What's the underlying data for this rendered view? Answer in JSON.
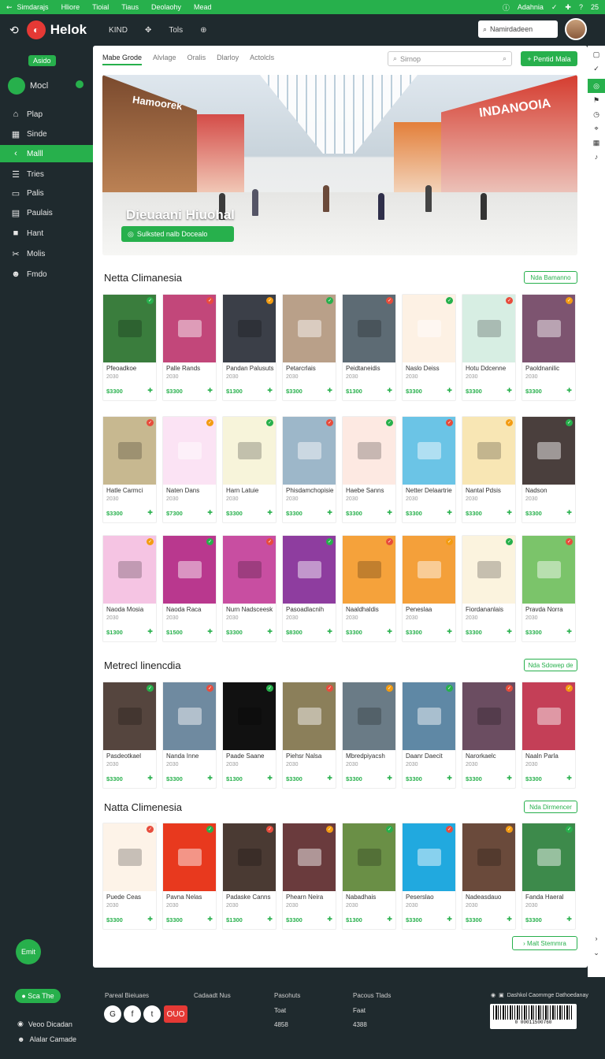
{
  "topbar": {
    "left": "Simdarajs",
    "nav": [
      "Hliore",
      "Tioial",
      "Tiaus",
      "Deolaohy",
      "Mead"
    ],
    "right": "Adahnia",
    "count": "25"
  },
  "header": {
    "logo": "Helok",
    "nav": [
      "KIND",
      "Tols"
    ],
    "search": "Namirdadeen"
  },
  "sidebar": {
    "badge": "Asido",
    "user": "Mocl",
    "items": [
      {
        "label": "Plap",
        "icon": "home-icon"
      },
      {
        "label": "Sinde",
        "icon": "grid-icon"
      },
      {
        "label": "Malll",
        "icon": "cart-icon",
        "active": true
      },
      {
        "label": "Tries",
        "icon": "list-icon"
      },
      {
        "label": "Palis",
        "icon": "card-icon"
      },
      {
        "label": "Paulais",
        "icon": "chart-icon"
      },
      {
        "label": "Hant",
        "icon": "box-icon"
      },
      {
        "label": "Molis",
        "icon": "tools-icon"
      },
      {
        "label": "Fmdo",
        "icon": "people-icon"
      }
    ],
    "fab": "Emit"
  },
  "main": {
    "tabs": [
      "Mabe Grode",
      "Alvlage",
      "Oralis",
      "Dlarloy",
      "Actolcls"
    ],
    "search_placeholder": "Sirnop",
    "primary_button": "Pentid Mala",
    "hero": {
      "title": "Dieuaani Hiuohal",
      "button": "Sulksted nalb Docealo",
      "store_left": "Hamoorek",
      "store_right": "INDANOOIA"
    },
    "sections": [
      {
        "title": "Netta Climanesia",
        "button": "Nda Bamanno",
        "rows": 3
      },
      {
        "title": "Metrecl linencdia",
        "button": "Nda Sdowep de",
        "rows": 1
      },
      {
        "title": "Natta Climenesia",
        "button": "Nda Dirmencer",
        "rows": 1
      }
    ],
    "more_button": "Malt Stemmra"
  },
  "products": [
    [
      {
        "name": "Pfeoadkoe",
        "sub": "2030",
        "price": "$3300",
        "bg": "#3a7d3d"
      },
      {
        "name": "Palle Rands",
        "sub": "2030",
        "price": "$3300",
        "bg": "#c2477a"
      },
      {
        "name": "Pandan Palusuts",
        "sub": "2030",
        "price": "$1300",
        "bg": "#3b3f48"
      },
      {
        "name": "Petarcrlais",
        "sub": "2030",
        "price": "$3300",
        "bg": "#b9a089"
      },
      {
        "name": "Peidtaneidis",
        "sub": "2030",
        "price": "$1300",
        "bg": "#5d6b74"
      },
      {
        "name": "Naslo Deiss",
        "sub": "2030",
        "price": "$3300",
        "bg": "#fdf1e4"
      },
      {
        "name": "Hotu Ddcenne",
        "sub": "2030",
        "price": "$3300",
        "bg": "#d7eee3"
      },
      {
        "name": "Paoldnanilic",
        "sub": "2030",
        "price": "$3300",
        "bg": "#7d5470"
      }
    ],
    [
      {
        "name": "Hatle Carmci",
        "sub": "2030",
        "price": "$3300",
        "bg": "#c7b890"
      },
      {
        "name": "Naten Dans",
        "sub": "2030",
        "price": "$7300",
        "bg": "#fbe3f4"
      },
      {
        "name": "Harn Latuie",
        "sub": "2030",
        "price": "$3300",
        "bg": "#f7f4da"
      },
      {
        "name": "Phisdamchopisie",
        "sub": "2030",
        "price": "$3300",
        "bg": "#9db7c9"
      },
      {
        "name": "Haebe Sanns",
        "sub": "2030",
        "price": "$3300",
        "bg": "#fde9e2"
      },
      {
        "name": "Netter Delaartrie",
        "sub": "2030",
        "price": "$3300",
        "bg": "#6bc4e6"
      },
      {
        "name": "Nantal Pdsis",
        "sub": "2030",
        "price": "$3300",
        "bg": "#f8e6b4"
      },
      {
        "name": "Nadson",
        "sub": "2030",
        "price": "$3300",
        "bg": "#4a3f3d"
      }
    ],
    [
      {
        "name": "Naoda Mosia",
        "sub": "2030",
        "price": "$1300",
        "bg": "#f5c4e3"
      },
      {
        "name": "Naoda Raca",
        "sub": "2030",
        "price": "$1500",
        "bg": "#b9388e"
      },
      {
        "name": "Nurn Nadsceesk",
        "sub": "2030",
        "price": "$3300",
        "bg": "#c84ea1"
      },
      {
        "name": "Pasoadlacnih",
        "sub": "2030",
        "price": "$8300",
        "bg": "#8e3d9f"
      },
      {
        "name": "Naaldhaldis",
        "sub": "2030",
        "price": "$3300",
        "bg": "#f5a23b"
      },
      {
        "name": "Peneslaa",
        "sub": "2030",
        "price": "$3300",
        "bg": "#f4a03a"
      },
      {
        "name": "Fiordananlais",
        "sub": "2030",
        "price": "$3300",
        "bg": "#fbf3de"
      },
      {
        "name": "Pravda Norra",
        "sub": "2030",
        "price": "$3300",
        "bg": "#7bc46a"
      }
    ],
    [
      {
        "name": "Pasdeotkael",
        "sub": "2030",
        "price": "$3300",
        "bg": "#55453e"
      },
      {
        "name": "Nanda Inne",
        "sub": "2030",
        "price": "$3300",
        "bg": "#6f8aa0"
      },
      {
        "name": "Paade Saane",
        "sub": "2030",
        "price": "$1300",
        "bg": "#111111"
      },
      {
        "name": "Piehsr Nalsa",
        "sub": "2030",
        "price": "$3300",
        "bg": "#8b7f5a"
      },
      {
        "name": "Mbredpiyacsh",
        "sub": "2030",
        "price": "$3300",
        "bg": "#6a7b86"
      },
      {
        "name": "Daanr Daecit",
        "sub": "2030",
        "price": "$3300",
        "bg": "#5f88a5"
      },
      {
        "name": "Narorkaelc",
        "sub": "2030",
        "price": "$3300",
        "bg": "#6b4d61"
      },
      {
        "name": "Naaln Parla",
        "sub": "2030",
        "price": "$3300",
        "bg": "#c43f57"
      }
    ],
    [
      {
        "name": "Puede Ceas",
        "sub": "2030",
        "price": "$3300",
        "bg": "#fdf3e8"
      },
      {
        "name": "Pavna Nelas",
        "sub": "2030",
        "price": "$3300",
        "bg": "#e8391e"
      },
      {
        "name": "Padaske Canns",
        "sub": "2030",
        "price": "$1300",
        "bg": "#4a3a33"
      },
      {
        "name": "Phearn Neira",
        "sub": "2030",
        "price": "$3300",
        "bg": "#6a3b3d"
      },
      {
        "name": "Nabadhais",
        "sub": "2030",
        "price": "$1300",
        "bg": "#6a8f46"
      },
      {
        "name": "Peserslao",
        "sub": "2030",
        "price": "$3300",
        "bg": "#21a9df"
      },
      {
        "name": "Nadeasdauo",
        "sub": "2030",
        "price": "$3300",
        "bg": "#6a4a3b"
      },
      {
        "name": "Fanda Haeral",
        "sub": "2030",
        "price": "$3300",
        "bg": "#3d8a4b"
      }
    ]
  ],
  "footer": {
    "badge": "Sca The",
    "links": [
      "Veoo Dicadan",
      "Alalar Camade"
    ],
    "cols": [
      {
        "title": "Pareal Bieiuaes",
        "values": []
      },
      {
        "title": "Cadaadt Nus",
        "values": []
      },
      {
        "title": "Pasohuts",
        "values": [
          "Toat",
          "4858"
        ]
      },
      {
        "title": "Pacous Tlads",
        "values": [
          "Faat",
          "4388"
        ]
      }
    ],
    "social_red": "OUO",
    "brand": "Dashkol Caommge Dathoedanay",
    "barcode": "0 00011500760"
  }
}
